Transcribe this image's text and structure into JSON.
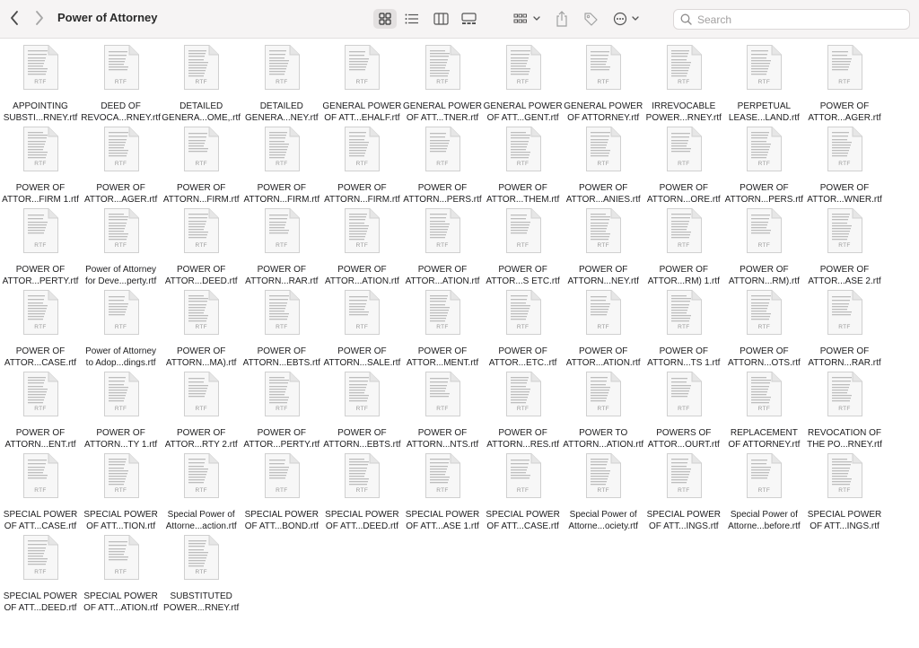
{
  "window": {
    "title": "Power of Attorney"
  },
  "toolbar": {
    "back_icon": "chevron-left-icon",
    "forward_icon": "chevron-right-icon",
    "views": [
      "icon-view",
      "list-view",
      "column-view",
      "gallery-view"
    ],
    "active_view": "icon-view"
  },
  "search": {
    "placeholder": "Search",
    "value": ""
  },
  "file_type_label": "RTF",
  "files": [
    [
      "APPOINTING",
      "SUBSTI...RNEY.rtf"
    ],
    [
      "DEED OF",
      "REVOCA...RNEY.rtf"
    ],
    [
      "DETAILED",
      "GENERA...OME,.rtf"
    ],
    [
      "DETAILED",
      "GENERA...NEY.rtf"
    ],
    [
      "GENERAL POWER",
      "OF ATT...EHALF.rtf"
    ],
    [
      "GENERAL POWER",
      "OF ATT...TNER.rtf"
    ],
    [
      "GENERAL POWER",
      "OF ATT...GENT.rtf"
    ],
    [
      "GENERAL POWER",
      "OF ATTORNEY.rtf"
    ],
    [
      "IRREVOCABLE",
      "POWER...RNEY.rtf"
    ],
    [
      "PERPETUAL",
      "LEASE...LAND.rtf"
    ],
    [
      "POWER OF",
      "ATTOR...AGER.rtf"
    ],
    [
      "POWER OF",
      "ATTOR...FIRM 1.rtf"
    ],
    [
      "POWER OF",
      "ATTOR...AGER.rtf"
    ],
    [
      "POWER OF",
      "ATTORN...FIRM.rtf"
    ],
    [
      "POWER OF",
      "ATTORN...FIRM.rtf"
    ],
    [
      "POWER OF",
      "ATTORN...FIRM.rtf"
    ],
    [
      "POWER OF",
      "ATTORN...PERS.rtf"
    ],
    [
      "POWER OF",
      "ATTOR...THEM.rtf"
    ],
    [
      "POWER OF",
      "ATTOR...ANIES.rtf"
    ],
    [
      "POWER OF",
      "ATTORN...ORE.rtf"
    ],
    [
      "POWER OF",
      "ATTORN...PERS.rtf"
    ],
    [
      "POWER OF",
      "ATTOR...WNER.rtf"
    ],
    [
      "POWER OF",
      "ATTOR...PERTY.rtf"
    ],
    [
      "Power of Attorney",
      "for Deve...perty.rtf"
    ],
    [
      "POWER OF",
      "ATTOR...DEED.rtf"
    ],
    [
      "POWER OF",
      "ATTORN...RAR.rtf"
    ],
    [
      "POWER OF",
      "ATTOR...ATION.rtf"
    ],
    [
      "POWER OF",
      "ATTOR...ATION.rtf"
    ],
    [
      "POWER OF",
      "ATTOR...S ETC.rtf"
    ],
    [
      "POWER OF",
      "ATTORN...NEY.rtf"
    ],
    [
      "POWER OF",
      "ATTOR...RM) 1.rtf"
    ],
    [
      "POWER OF",
      "ATTORN...RM).rtf"
    ],
    [
      "POWER OF",
      "ATTOR...ASE 2.rtf"
    ],
    [
      "POWER OF",
      "ATTOR...CASE.rtf"
    ],
    [
      "Power of Attorney",
      "to Adop...dings.rtf"
    ],
    [
      "POWER OF",
      "ATTORN...MA).rtf"
    ],
    [
      "POWER OF",
      "ATTORN...EBTS.rtf"
    ],
    [
      "POWER OF",
      "ATTORN...SALE.rtf"
    ],
    [
      "POWER OF",
      "ATTOR...MENT.rtf"
    ],
    [
      "POWER OF",
      "ATTOR...ETC..rtf"
    ],
    [
      "POWER OF",
      "ATTOR...ATION.rtf"
    ],
    [
      "POWER OF",
      "ATTORN...TS 1.rtf"
    ],
    [
      "POWER OF",
      "ATTORN...OTS.rtf"
    ],
    [
      "POWER OF",
      "ATTORN...RAR.rtf"
    ],
    [
      "POWER OF",
      "ATTORN...ENT.rtf"
    ],
    [
      "POWER OF",
      "ATTORN...TY 1.rtf"
    ],
    [
      "POWER OF",
      "ATTOR...RTY 2.rtf"
    ],
    [
      "POWER OF",
      "ATTOR...PERTY.rtf"
    ],
    [
      "POWER OF",
      "ATTORN...EBTS.rtf"
    ],
    [
      "POWER OF",
      "ATTORN...NTS.rtf"
    ],
    [
      "POWER OF",
      "ATTORN...RES.rtf"
    ],
    [
      "POWER TO",
      "ATTORN...ATION.rtf"
    ],
    [
      "POWERS OF",
      "ATTOR...OURT.rtf"
    ],
    [
      "REPLACEMENT",
      "OF ATTORNEY.rtf"
    ],
    [
      "REVOCATION OF",
      "THE PO...RNEY.rtf"
    ],
    [
      "SPECIAL POWER",
      "OF ATT...CASE.rtf"
    ],
    [
      "SPECIAL POWER",
      "OF ATT...TION.rtf"
    ],
    [
      "Special Power of",
      "Attorne...action.rtf"
    ],
    [
      "SPECIAL POWER",
      "OF ATT...BOND.rtf"
    ],
    [
      "SPECIAL POWER",
      "OF ATT...DEED.rtf"
    ],
    [
      "SPECIAL POWER",
      "OF ATT...ASE 1.rtf"
    ],
    [
      "SPECIAL POWER",
      "OF ATT...CASE.rtf"
    ],
    [
      "Special Power of",
      "Attorne...ociety.rtf"
    ],
    [
      "SPECIAL POWER",
      "OF ATT...INGS.rtf"
    ],
    [
      "Special Power of",
      "Attorne...before.rtf"
    ],
    [
      "SPECIAL POWER",
      "OF ATT...INGS.rtf"
    ],
    [
      "SPECIAL POWER",
      "OF ATT...DEED.rtf"
    ],
    [
      "SPECIAL POWER",
      "OF ATT...ATION.rtf"
    ],
    [
      "SUBSTITUTED",
      "POWER...RNEY.rtf"
    ]
  ]
}
